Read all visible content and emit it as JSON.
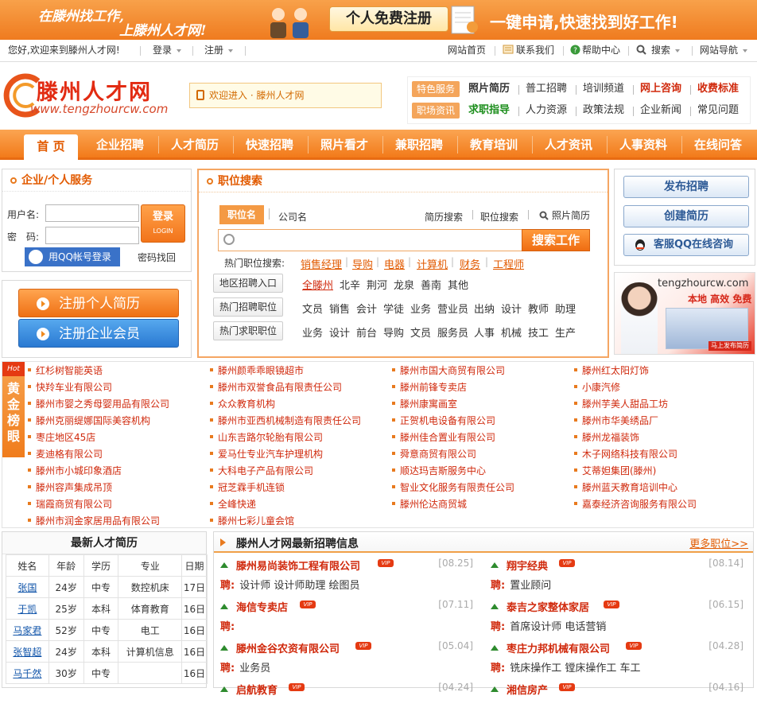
{
  "banner": {
    "slogan_line1": "在滕州找工作,",
    "slogan_line2": "上滕州人才网!",
    "register_label": "个人免费注册",
    "slogan_right": "一键申请,快速找到好工作!"
  },
  "topbar": {
    "welcome": "您好,欢迎来到滕州人才网!",
    "login": "登录",
    "register": "注册",
    "links": [
      "网站首页",
      "联系我们",
      "帮助中心",
      "搜索",
      "网站导航"
    ]
  },
  "header": {
    "logo_text": "滕州人才网",
    "logo_url": "www.tengzhourcw.com",
    "welcome_box": "欢迎进入 · 滕州人才网",
    "quick_tags": [
      "特色服务",
      "职场资讯"
    ],
    "quick_row1": [
      "照片简历",
      "普工招聘",
      "培训频道",
      "网上咨询",
      "收费标准"
    ],
    "quick_row2": [
      "求职指导",
      "人力资源",
      "政策法规",
      "企业新闻",
      "常见问题"
    ]
  },
  "nav": [
    "首 页",
    "企业招聘",
    "人才简历",
    "快速招聘",
    "照片看才",
    "兼职招聘",
    "教育培训",
    "人才资讯",
    "人事资料",
    "在线问答"
  ],
  "service": {
    "title": "企业/个人服务",
    "username_label": "用户名:",
    "password_label": "密　码:",
    "login_btn": "登录",
    "login_btn_sub": "LOGIN",
    "qq_login": "用QQ帐号登录",
    "find_pwd": "密码找回",
    "register_person": "注册个人简历",
    "register_company": "注册企业会员"
  },
  "search": {
    "title": "职位搜索",
    "tabs": [
      "职位名",
      "公司名"
    ],
    "links": [
      "简历搜索",
      "职位搜索",
      "照片简历"
    ],
    "button": "搜索工作",
    "hot_label": "热门职位搜索:",
    "hot_keywords": [
      "销售经理",
      "导购",
      "电器",
      "计算机",
      "财务",
      "工程师"
    ],
    "rows": [
      {
        "label": "地区招聘入口",
        "items": [
          "全滕州",
          "北辛",
          "荆河",
          "龙泉",
          "善南",
          "其他"
        ]
      },
      {
        "label": "热门招聘职位",
        "items": [
          "文员",
          "销售",
          "会计",
          "学徒",
          "业务",
          "营业员",
          "出纳",
          "设计",
          "教师",
          "助理"
        ]
      },
      {
        "label": "热门求职职位",
        "items": [
          "业务",
          "设计",
          "前台",
          "导购",
          "文员",
          "服务员",
          "人事",
          "机械",
          "技工",
          "生产"
        ]
      }
    ]
  },
  "right": {
    "buttons": [
      "发布招聘",
      "创建简历",
      "客服QQ在线咨询"
    ],
    "ad_url": "tengzhourcw.com",
    "ad_slogan": "本地 高效 免费",
    "ad_button": "马上发布简历"
  },
  "gold": {
    "side_hot": "Hot",
    "side_title": "黄金榜眼",
    "col1": [
      "红杉树智能英语",
      "快羚车业有限公司",
      "滕州市婴之秀母婴用品有限公司",
      "滕州克丽缇娜国际美容机构",
      "枣庄地区45店",
      "麦迪格有限公司",
      "滕州市小城印象酒店",
      "滕州容声集成吊顶",
      "瑞霞商贸有限公司",
      "滕州市润金家居用品有限公司"
    ],
    "col2": [
      "滕州颜乖乖眼镜超市",
      "滕州市双誉食品有限责任公司",
      "众众教育机构",
      "滕州市亚西机械制造有限责任公司",
      "山东吉路尔轮胎有限公司",
      "爱马仕专业汽车护理机构",
      "大科电子产品有限公司",
      "冠芝霖手机连锁",
      "全峰快递",
      "滕州七彩儿童会馆"
    ],
    "col3": [
      "滕州市国大商贸有限公司",
      "滕州前锋专卖店",
      "滕州康寓画室",
      "正贺机电设备有限公司",
      "滕州佳合置业有限公司",
      "舜意商贸有限公司",
      "顺达玛吉斯服务中心",
      "智业文化服务有限责任公司",
      "滕州伦达商贸城"
    ],
    "col4": [
      "滕州红太阳灯饰",
      "小康汽修",
      "滕州芋美人甜品工坊",
      "滕州市华美绣品厂",
      "滕州龙福装饰",
      "木子网络科技有限公司",
      "艾蒂妲集团(滕州)",
      "滕州蓝天教育培训中心",
      "嘉泰经济咨询服务有限公司"
    ]
  },
  "resumes": {
    "title": "最新人才简历",
    "headers": [
      "姓名",
      "年龄",
      "学历",
      "专业",
      "日期"
    ],
    "rows": [
      [
        "张国",
        "24岁",
        "中专",
        "数控机床",
        "17日"
      ],
      [
        "于凯",
        "25岁",
        "本科",
        "体育教育",
        "16日"
      ],
      [
        "马家君",
        "52岁",
        "中专",
        "电工",
        "16日"
      ],
      [
        "张智超",
        "24岁",
        "本科",
        "计算机信息",
        "16日"
      ],
      [
        "马千然",
        "30岁",
        "中专",
        "",
        "16日"
      ]
    ]
  },
  "jobs": {
    "title": "滕州人才网最新招聘信息",
    "more": "更多职位>>",
    "vip": "VIP",
    "hire_label": "聘:",
    "items": [
      {
        "company": "滕州易尚装饰工程有限公司",
        "date": "[08.25]",
        "positions": "设计师  设计师助理  绘图员"
      },
      {
        "company": "翔宇经典",
        "date": "[08.14]",
        "positions": "置业顾问"
      },
      {
        "company": "海信专卖店",
        "date": "[07.11]",
        "positions": ""
      },
      {
        "company": "泰吉之家整体家居",
        "date": "[06.15]",
        "positions": "首席设计师  电话营销"
      },
      {
        "company": "滕州金谷农资有限公司",
        "date": "[05.04]",
        "positions": "业务员"
      },
      {
        "company": "枣庄力邦机械有限公司",
        "date": "[04.28]",
        "positions": "铣床操作工  镗床操作工  车工"
      },
      {
        "company": "启航教育",
        "date": "[04.24]",
        "positions": ""
      },
      {
        "company": "湘信房产",
        "date": "[04.16]",
        "positions": ""
      }
    ]
  }
}
